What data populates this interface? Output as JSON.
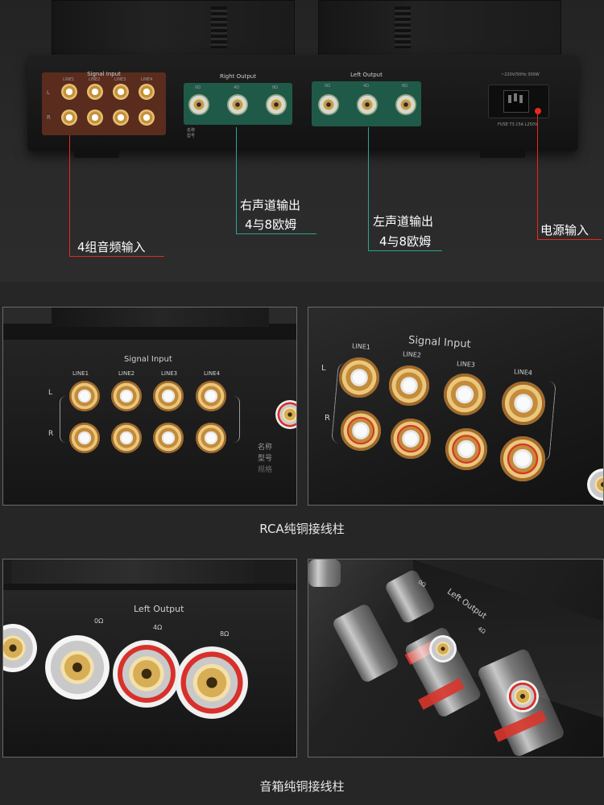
{
  "hero": {
    "panel": {
      "signal_input_title": "Signal  Input",
      "line_labels": [
        "LINE1",
        "LINE2",
        "LINE3",
        "LINE4"
      ],
      "channel_l": "L",
      "channel_r": "R",
      "right_output_title": "Right  Output",
      "left_output_title": "Left  Output",
      "ohm_labels": [
        "0Ω",
        "4Ω",
        "8Ω"
      ],
      "model_label": "型号",
      "name_label": "名称",
      "power_rating": "~220V/50Hz 300W",
      "fuse_rating": "FUSE T3.15A L250V"
    },
    "callouts": {
      "right_output_line1": "右声道输出",
      "right_output_line2": "4与8欧姆",
      "left_output_line1": "左声道输出",
      "left_output_line2": "4与8欧姆",
      "power_input": "电源输入",
      "audio_inputs": "4组音频输入"
    },
    "colors": {
      "input_panel": "#5a2c1e",
      "output_panel": "#1f5a48",
      "accent_red": "#e8281e"
    }
  },
  "rca_photos": {
    "left": {
      "title": "Signal  Input",
      "lines": [
        "LINE1",
        "LINE2",
        "LINE3",
        "LINE4"
      ],
      "l": "L",
      "r": "R",
      "side_text": [
        "名称",
        "型号",
        "规格"
      ]
    },
    "right": {
      "title": "Signal  Input",
      "lines": [
        "LINE1",
        "LINE2",
        "LINE3",
        "LINE4"
      ],
      "l": "L",
      "r": "R"
    },
    "caption": "RCA纯铜接线柱"
  },
  "speaker_photos": {
    "left": {
      "title": "Left  Output",
      "ohms": [
        "0Ω",
        "4Ω",
        "8Ω"
      ]
    },
    "right": {
      "labels": [
        "Left  Output",
        "0Ω",
        "4Ω"
      ]
    },
    "caption": "音箱纯铜接线柱"
  }
}
